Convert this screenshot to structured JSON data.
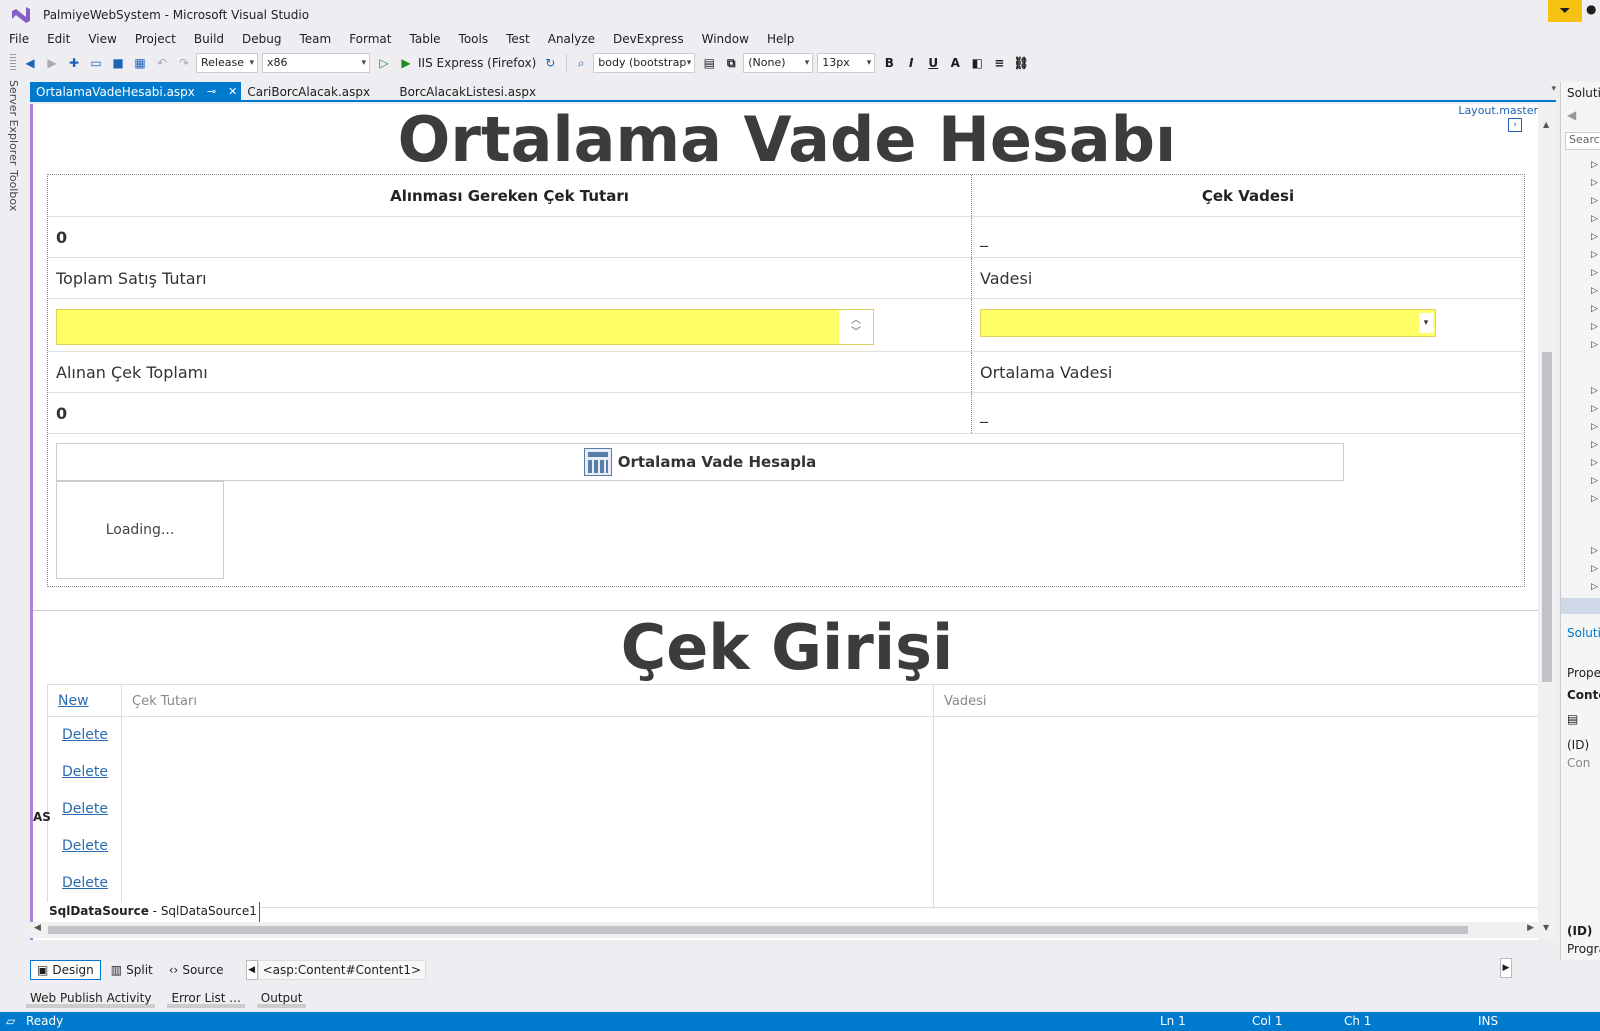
{
  "window": {
    "title": "PalmiyeWebSystem - Microsoft Visual Studio"
  },
  "menu": [
    "File",
    "Edit",
    "View",
    "Project",
    "Build",
    "Debug",
    "Team",
    "Format",
    "Table",
    "Tools",
    "Test",
    "Analyze",
    "DevExpress",
    "Window",
    "Help"
  ],
  "toolbar": {
    "config": "Release",
    "platform": "x86",
    "run_target": "IIS Express (Firefox)",
    "block_format": "body (bootstrap",
    "style": "(None)",
    "font_size": "13px",
    "bold": "B",
    "italic": "I",
    "underline": "U"
  },
  "side_tabs": {
    "server_explorer": "Server Explorer",
    "toolbox": "Toolbox"
  },
  "doc_tabs": [
    {
      "label": "OrtalamaVadeHesabi.aspx",
      "active": true
    },
    {
      "label": "CariBorcAlacak.aspx",
      "active": false
    },
    {
      "label": "BorcAlacakListesi.aspx",
      "active": false
    }
  ],
  "designer": {
    "layout_master": "Layout.master",
    "heading1": "Ortalama Vade Hesabı",
    "table": {
      "col_amount_header": "Alınması Gereken Çek Tutarı",
      "col_due_header": "Çek Vadesi",
      "amount_value": "0",
      "due_value": "_",
      "total_sales_label": "Toplam Satış Tutarı",
      "term_label": "Vadesi",
      "cheque_total_label": "Alınan Çek Toplamı",
      "avg_term_label": "Ortalama Vadesi",
      "cheque_total_value": "0",
      "avg_term_value": "_"
    },
    "calc_button": "Ortalama Vade Hesapla",
    "loading": "Loading...",
    "heading2": "Çek Girişi",
    "grid": {
      "new_link": "New",
      "col_amount": "Çek Tutarı",
      "col_due": "Vadesi",
      "delete_links": [
        "Delete",
        "Delete",
        "Delete",
        "Delete",
        "Delete"
      ]
    },
    "sqlds_type": "SqlDataSource",
    "sqlds_sep": " - ",
    "sqlds_name": "SqlDataSource1",
    "asp_label": "AS"
  },
  "view_bar": {
    "design": "Design",
    "split": "Split",
    "source": "Source",
    "breadcrumb": "<asp:Content#Content1>"
  },
  "bottom_tabs": [
    "Web Publish Activity",
    "Error List ...",
    "Output"
  ],
  "status": {
    "ready": "Ready",
    "ln": "Ln 1",
    "col": "Col 1",
    "ch": "Ch 1",
    "ins": "INS"
  },
  "right_panel": {
    "solution": "Solution Explorer",
    "search": "Search",
    "solution_link": "Solution",
    "properties": "Properties",
    "content": "Content",
    "id": "(ID)",
    "con": "Con",
    "id2": "(ID)",
    "prog": "Programmatic"
  },
  "colors": {
    "accent": "#007acc",
    "field_highlight": "#ffff66",
    "filter": "#f5c211"
  }
}
